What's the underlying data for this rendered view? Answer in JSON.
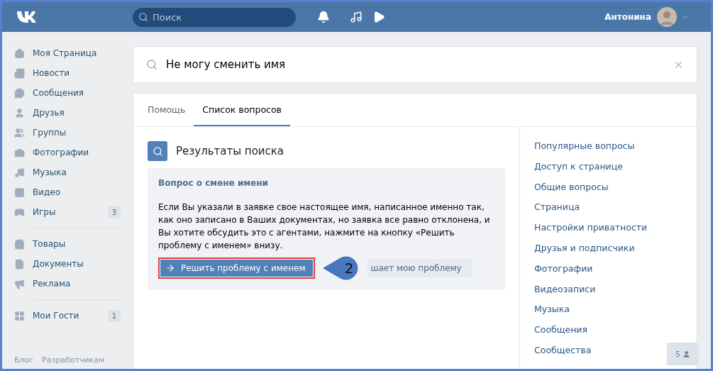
{
  "header": {
    "search": {
      "placeholder": "Поиск"
    },
    "user": {
      "name": "Антонина"
    }
  },
  "sidebar": {
    "groups": [
      [
        {
          "label": "Моя Страница"
        },
        {
          "label": "Новости"
        },
        {
          "label": "Сообщения"
        },
        {
          "label": "Друзья"
        },
        {
          "label": "Группы"
        },
        {
          "label": "Фотографии"
        },
        {
          "label": "Музыка"
        },
        {
          "label": "Видео"
        },
        {
          "label": "Игры",
          "badge": "3"
        }
      ],
      [
        {
          "label": "Товары"
        },
        {
          "label": "Документы"
        },
        {
          "label": "Реклама"
        }
      ],
      [
        {
          "label": "Мои Гости",
          "badge": "1"
        }
      ]
    ],
    "footer": [
      "Блог",
      "Разработчикам"
    ]
  },
  "query": {
    "value": "Не могу сменить имя"
  },
  "tabs": [
    {
      "label": "Помощь",
      "selected": false
    },
    {
      "label": "Список вопросов",
      "selected": true
    }
  ],
  "results": {
    "title": "Результаты поиска",
    "item": {
      "title": "Вопрос о смене имени",
      "text": "Если Вы указали в заявке свое настоящее имя, написанное именно так, как оно записано в Ваших документах, но заявка все равно отклонена, и Вы хотите обсудить это с агентами, нажмите на кнопку «Решить проблему с именем» внизу.",
      "primary_button": "Решить проблему с именем",
      "secondary_button": "шает мою проблему",
      "callout": "2"
    }
  },
  "categories": [
    {
      "label": "Популярные вопросы"
    },
    {
      "label": "Доступ к странице"
    },
    {
      "label": "Общие вопросы"
    },
    {
      "label": "Страница"
    },
    {
      "label": "Настройки приватности"
    },
    {
      "label": "Друзья и подписчики"
    },
    {
      "label": "Фотографии"
    },
    {
      "label": "Видеозаписи"
    },
    {
      "label": "Музыка"
    },
    {
      "label": "Сообщения"
    },
    {
      "label": "Сообщества"
    }
  ],
  "chat_badge": {
    "count": "5"
  }
}
